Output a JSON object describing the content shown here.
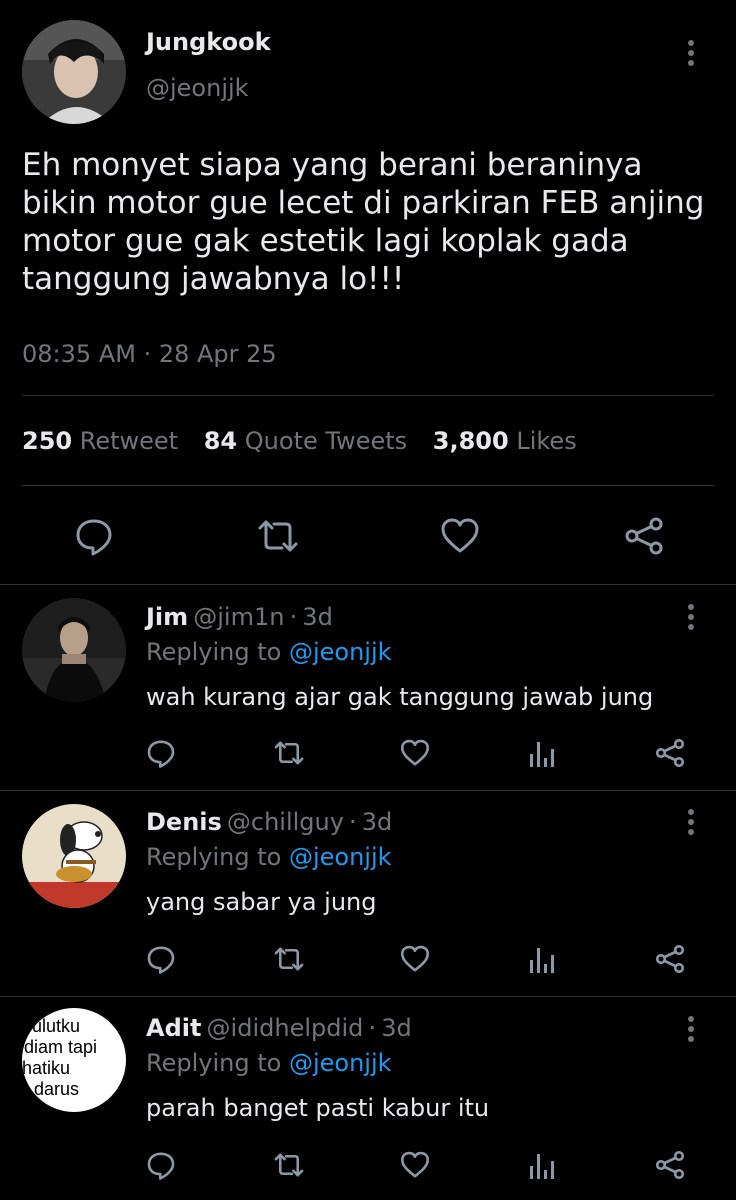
{
  "tweet": {
    "author": {
      "name": "Jungkook",
      "handle": "@jeonjjk"
    },
    "text_lines": [
      "Eh monyet siapa yang berani beraninya",
      "bikin motor gue lecet di parkiran FEB anjing",
      "motor gue gak estetik lagi koplak gada",
      "tanggung jawabnya lo!!!"
    ],
    "time": "08:35 AM",
    "sep": "·",
    "date": "28 Apr 25",
    "stats": {
      "retweets": {
        "count": "250",
        "label": "Retweet"
      },
      "quotes": {
        "count": "84",
        "label": "Quote Tweets"
      },
      "likes": {
        "count": "3,800",
        "label": "Likes"
      }
    },
    "actions": [
      "reply-icon",
      "retweet-icon",
      "like-icon",
      "share-icon"
    ]
  },
  "replies": [
    {
      "name": "Jim",
      "handle": "@jim1n",
      "sep": "·",
      "age": "3d",
      "replying_prefix": "Replying to",
      "replying_to": "@jeonjjk",
      "text": "wah kurang ajar gak tanggung jawab jung"
    },
    {
      "name": "Denis",
      "handle": "@chillguy",
      "sep": "·",
      "age": "3d",
      "replying_prefix": "Replying to",
      "replying_to": "@jeonjjk",
      "text": "yang sabar ya jung"
    },
    {
      "name": "Adit",
      "handle": "@ididhelpdid",
      "sep": "·",
      "age": "3d",
      "replying_prefix": "Replying to",
      "replying_to": "@jeonjjk",
      "text": "parah banget pasti kabur itu",
      "avatar_text": [
        "ulutku",
        "diam tapi",
        "hatiku",
        "darus"
      ]
    }
  ],
  "reply_actions": [
    "reply-icon",
    "retweet-icon",
    "like-icon",
    "analytics-icon",
    "share-icon"
  ],
  "colors": {
    "background": "#000000",
    "text": "#e7e9ea",
    "muted": "#71767b",
    "link": "#1d9bf0",
    "divider": "#2f3336"
  }
}
